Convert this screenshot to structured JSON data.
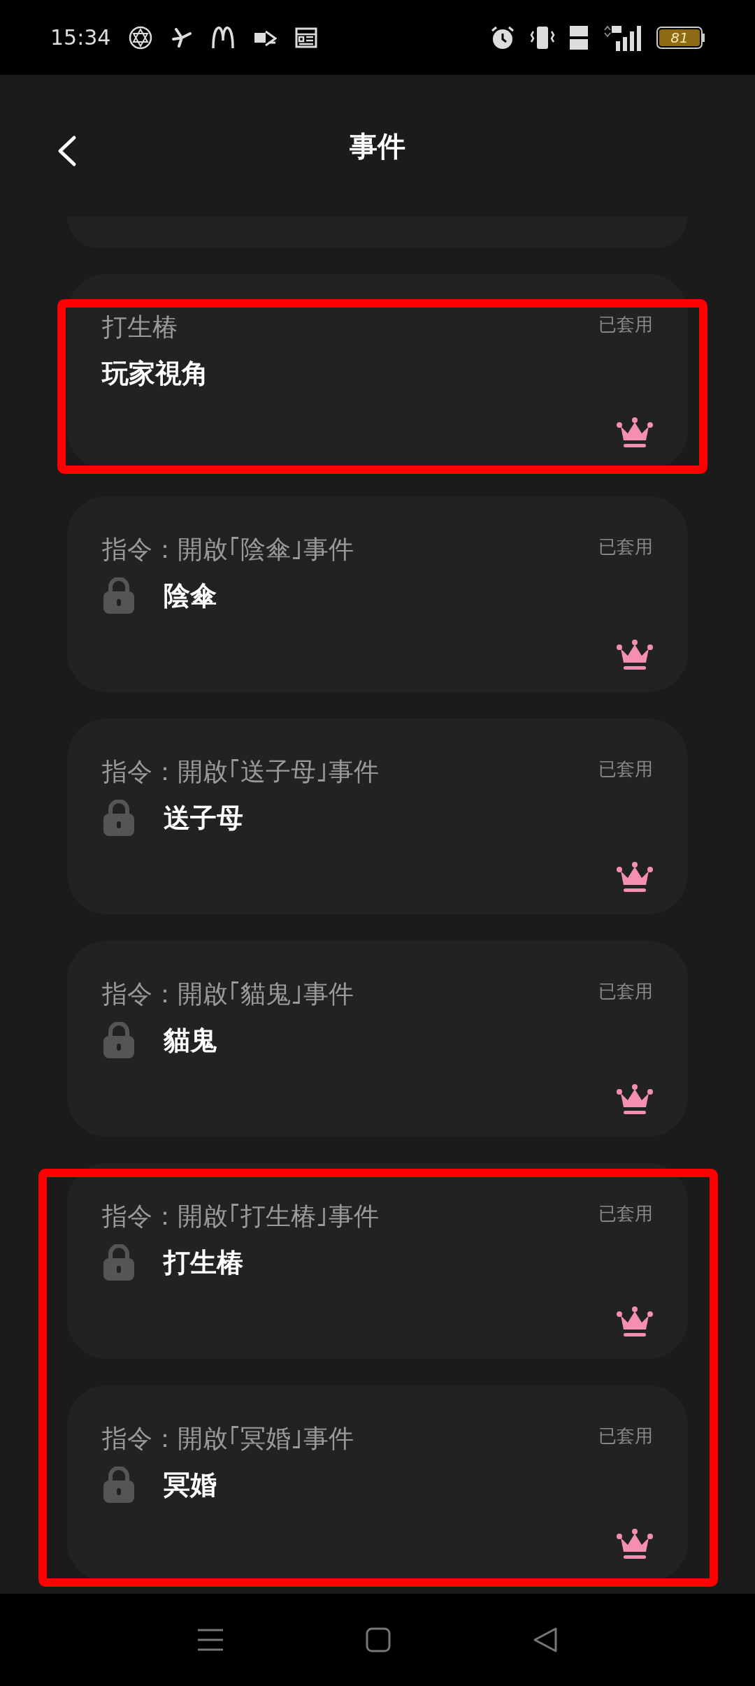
{
  "status_bar": {
    "time": "15:34",
    "battery": "81"
  },
  "header": {
    "title": "事件"
  },
  "events": [
    {
      "title": "打生椿",
      "name": "玩家視角",
      "status": "已套用",
      "locked": false,
      "highlighted": true
    },
    {
      "title": "指令：開啟｢陰傘｣事件",
      "name": "陰傘",
      "status": "已套用",
      "locked": true,
      "highlighted": false
    },
    {
      "title": "指令：開啟｢送子母｣事件",
      "name": "送子母",
      "status": "已套用",
      "locked": true,
      "highlighted": false
    },
    {
      "title": "指令：開啟｢貓鬼｣事件",
      "name": "貓鬼",
      "status": "已套用",
      "locked": true,
      "highlighted": false
    },
    {
      "title": "指令：開啟｢打生椿｣事件",
      "name": "打生椿",
      "status": "已套用",
      "locked": true,
      "highlighted": true
    },
    {
      "title": "指令：開啟｢冥婚｣事件",
      "name": "冥婚",
      "status": "已套用",
      "locked": true,
      "highlighted": true
    }
  ]
}
